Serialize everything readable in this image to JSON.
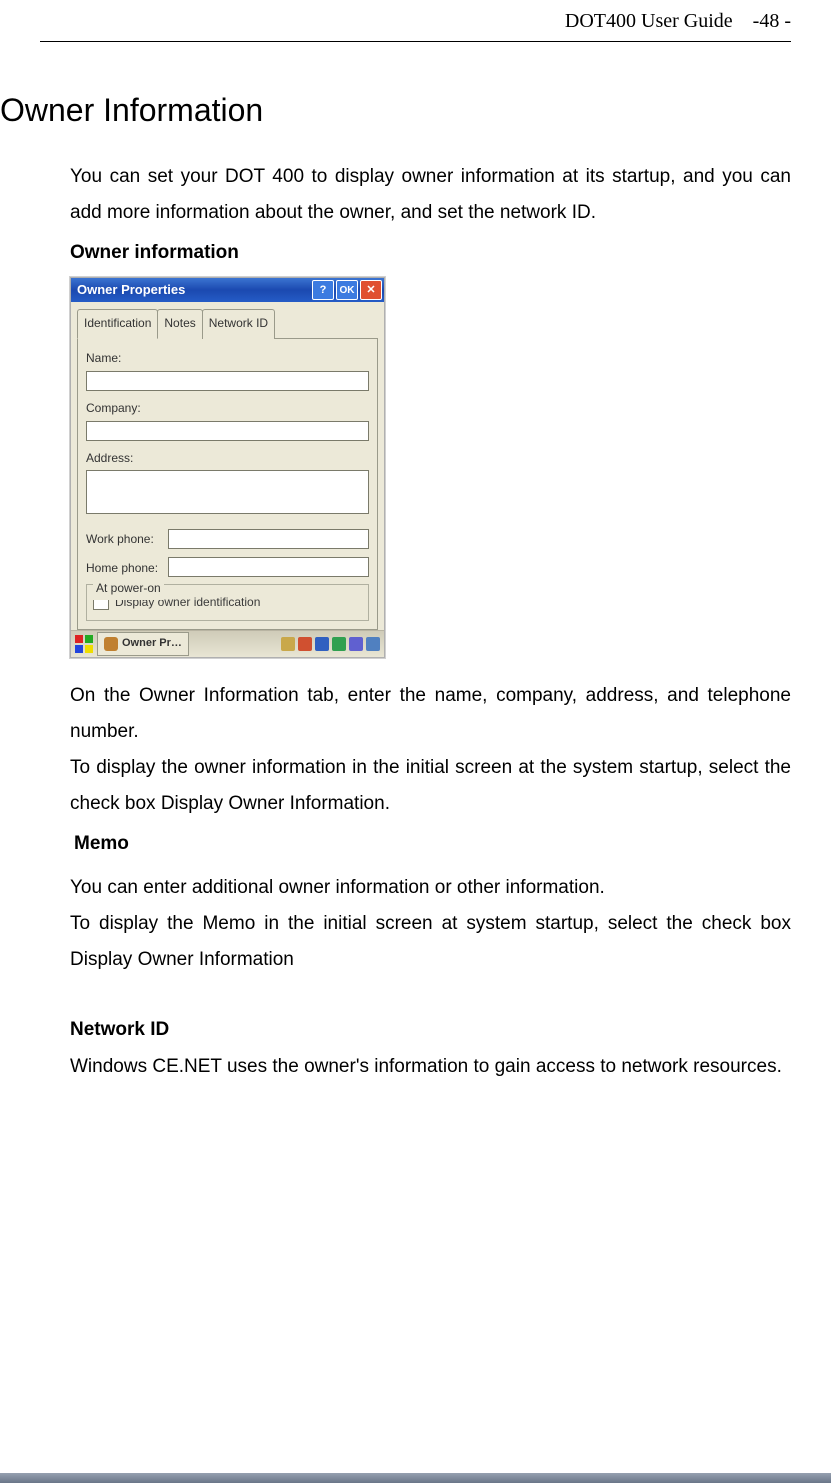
{
  "header": {
    "doc_title": "DOT400 User Guide",
    "page_number": "-48 -"
  },
  "section": {
    "title": "Owner Information",
    "intro": "You can set your DOT 400 to display owner information at its startup, and you can add more information about the owner, and set the network ID.",
    "owner_info_heading": "Owner information",
    "para1": "On the Owner Information tab, enter the name, company, address, and telephone number.",
    "para2": "To display the owner information in the initial screen at the system startup, select the check box Display Owner Information.",
    "memo_heading": "Memo",
    "memo1": "You can enter additional owner information or other information.",
    "memo2": "To display the Memo in the initial screen at system startup, select the check box Display Owner Information",
    "netid_heading": "Network ID",
    "netid_body": "Windows CE.NET uses the owner's information to gain access to network resources."
  },
  "screenshot": {
    "window_title": "Owner Properties",
    "btn_help": "?",
    "btn_ok": "OK",
    "btn_close": "✕",
    "tabs": {
      "identification": "Identification",
      "notes": "Notes",
      "network_id": "Network ID"
    },
    "fields": {
      "name": "Name:",
      "company": "Company:",
      "address": "Address:",
      "work_phone": "Work phone:",
      "home_phone": "Home phone:"
    },
    "group": {
      "legend": "At power-on",
      "checkbox": "Display owner identification"
    },
    "taskbar": {
      "task_button": "Owner Pr…"
    }
  }
}
